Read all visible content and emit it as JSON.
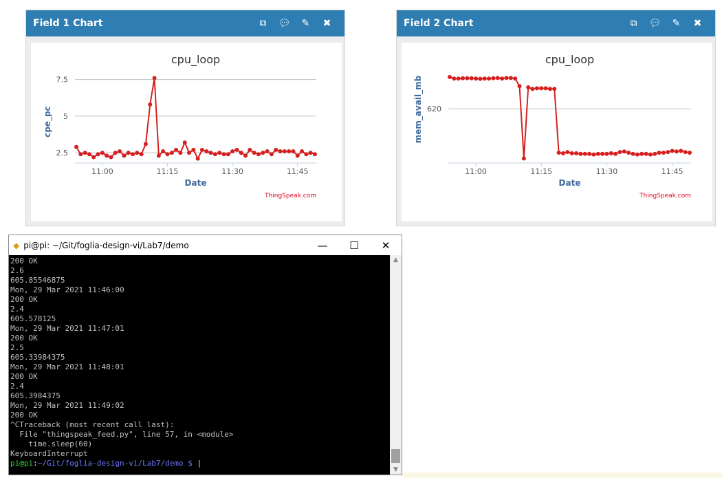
{
  "panels": [
    {
      "header": "Field 1 Chart",
      "icons": [
        "external-link-icon",
        "comment-icon",
        "pencil-icon",
        "close-icon"
      ]
    },
    {
      "header": "Field 2 Chart",
      "icons": [
        "external-link-icon",
        "comment-icon",
        "pencil-icon",
        "close-icon"
      ]
    }
  ],
  "colors": {
    "header": "#2e7db3",
    "series": "#d62020",
    "axis_label": "#3f6a9c",
    "credit": "#e0001b"
  },
  "chart_data": [
    {
      "type": "line",
      "title": "cpu_loop",
      "xlabel": "Date",
      "ylabel": "cpe_pc",
      "credit": "ThingSpeak.com",
      "xtick_labels": [
        "11:00",
        "11:15",
        "11:30",
        "11:45"
      ],
      "ytick_values": [
        2.5,
        5,
        7.5
      ],
      "ytick_labels": [
        "2.5",
        "5",
        "7.5"
      ],
      "ylim": [
        1.8,
        8.0
      ],
      "x_start": "10:54",
      "x_end": "11:49",
      "x_interval_min": 1,
      "grid": true,
      "series": [
        {
          "values": [
            2.9,
            2.4,
            2.5,
            2.4,
            2.2,
            2.4,
            2.5,
            2.3,
            2.2,
            2.5,
            2.6,
            2.3,
            2.5,
            2.4,
            2.5,
            2.4,
            3.1,
            5.8,
            7.6,
            2.3,
            2.6,
            2.4,
            2.5,
            2.7,
            2.5,
            3.2,
            2.5,
            2.7,
            2.1,
            2.7,
            2.6,
            2.5,
            2.4,
            2.5,
            2.4,
            2.4,
            2.6,
            2.7,
            2.5,
            2.3,
            2.7,
            2.5,
            2.4,
            2.5,
            2.6,
            2.4,
            2.7,
            2.6,
            2.6,
            2.6,
            2.6,
            2.3,
            2.6,
            2.4,
            2.5,
            2.4
          ]
        }
      ]
    },
    {
      "type": "line",
      "title": "cpu_loop",
      "xlabel": "Date",
      "ylabel": "mem_avail_mb",
      "credit": "ThingSpeak.com",
      "xtick_labels": [
        "11:00",
        "11:15",
        "11:30",
        "11:45"
      ],
      "ytick_values": [
        620
      ],
      "ytick_labels": [
        "620"
      ],
      "ylim": [
        602.1,
        632.1
      ],
      "x_start": "10:54",
      "x_end": "11:49",
      "x_interval_min": 1,
      "grid": true,
      "series": [
        {
          "values": [
            630.5,
            630.0,
            630.0,
            630.1,
            630.1,
            630.1,
            630.0,
            629.9,
            630.0,
            630.0,
            630.1,
            630.2,
            630.0,
            630.2,
            630.2,
            630.0,
            627.5,
            603.6,
            627.1,
            626.6,
            626.8,
            626.8,
            626.8,
            626.6,
            626.6,
            605.5,
            605.3,
            605.7,
            605.3,
            605.3,
            605.1,
            605.1,
            605.1,
            604.9,
            605.1,
            605.1,
            605.1,
            605.3,
            605.1,
            605.7,
            605.9,
            605.5,
            605.1,
            604.9,
            605.1,
            605.1,
            604.9,
            605.1,
            605.5,
            605.5,
            605.7,
            606.1,
            605.9,
            606.1,
            605.7,
            605.5
          ]
        }
      ]
    }
  ],
  "terminal": {
    "title": "pi@pi: ~/Git/foglia-design-vi/Lab7/demo",
    "lines": [
      "200 OK",
      "2.6",
      "605.85546875",
      "Mon, 29 Mar 2021 11:46:00",
      "200 OK",
      "2.4",
      "605.578125",
      "Mon, 29 Mar 2021 11:47:01",
      "200 OK",
      "2.5",
      "605.33984375",
      "Mon, 29 Mar 2021 11:48:01",
      "200 OK",
      "2.4",
      "605.3984375",
      "Mon, 29 Mar 2021 11:49:02",
      "200 OK",
      "^CTraceback (most recent call last):",
      "  File \"thingspeak_feed.py\", line 57, in <module>",
      "    time.sleep(60)",
      "KeyboardInterrupt"
    ],
    "prompt": {
      "user": "pi@pi",
      "sep": ":",
      "path": "~/Git/foglia-design-vi/Lab7/demo $ "
    },
    "buttons": {
      "minimize": "—",
      "maximize": "☐",
      "close": "✕"
    }
  }
}
